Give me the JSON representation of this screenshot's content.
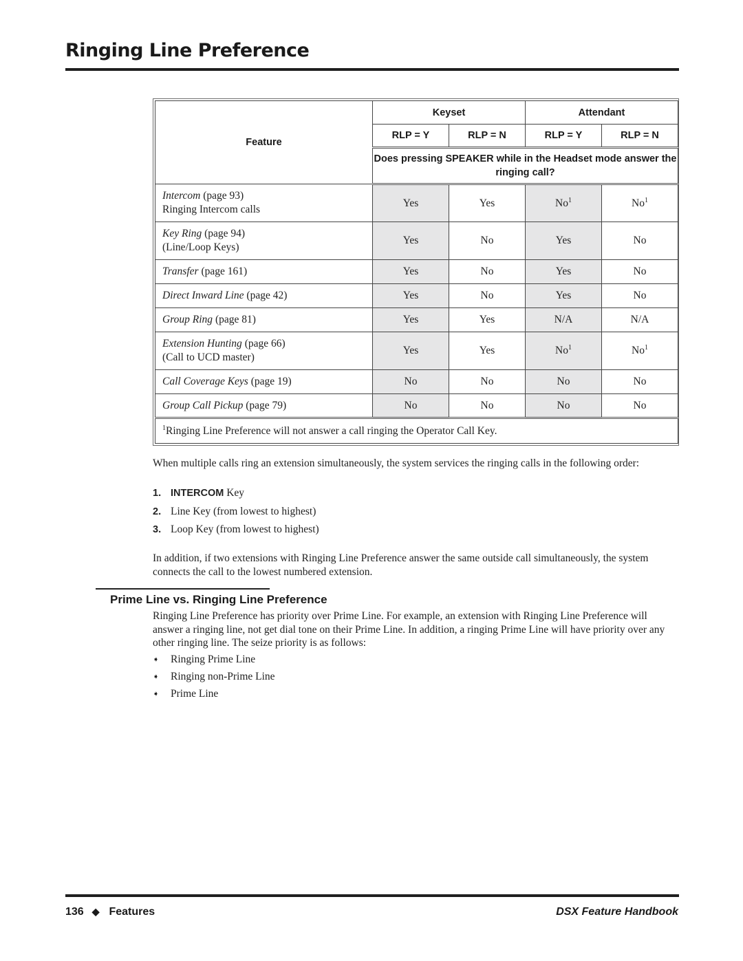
{
  "header": {
    "title": "Ringing Line Preference"
  },
  "table": {
    "feature_header": "Feature",
    "groups": [
      "Keyset",
      "Attendant"
    ],
    "rlp_headers": [
      "RLP = Y",
      "RLP = N",
      "RLP = Y",
      "RLP = N"
    ],
    "question_pre": "Does pressing ",
    "question_key": "SPEAKER",
    "question_post": " while in the Headset mode answer the ringing call?",
    "rows": [
      {
        "feature": "Intercom",
        "page": " (page 93)",
        "sub": "Ringing Intercom calls",
        "values": [
          "Yes",
          "Yes",
          "No",
          "No"
        ],
        "notes": [
          "",
          "",
          "1",
          "1"
        ]
      },
      {
        "feature": "Key Ring",
        "page": " (page 94)",
        "sub": "(Line/Loop Keys)",
        "values": [
          "Yes",
          "No",
          "Yes",
          "No"
        ],
        "notes": [
          "",
          "",
          "",
          ""
        ]
      },
      {
        "feature": "Transfer",
        "page": " (page 161)",
        "sub": "",
        "values": [
          "Yes",
          "No",
          "Yes",
          "No"
        ],
        "notes": [
          "",
          "",
          "",
          ""
        ]
      },
      {
        "feature": "Direct Inward Line",
        "page": " (page 42)",
        "sub": "",
        "values": [
          "Yes",
          "No",
          "Yes",
          "No"
        ],
        "notes": [
          "",
          "",
          "",
          ""
        ]
      },
      {
        "feature": "Group Ring",
        "page": " (page 81)",
        "sub": "",
        "values": [
          "Yes",
          "Yes",
          "N/A",
          "N/A"
        ],
        "notes": [
          "",
          "",
          "",
          ""
        ]
      },
      {
        "feature": "Extension Hunting",
        "page": " (page 66)",
        "sub": "(Call to UCD master)",
        "values": [
          "Yes",
          "Yes",
          "No",
          "No"
        ],
        "notes": [
          "",
          "",
          "1",
          "1"
        ]
      },
      {
        "feature": "Call Coverage Keys",
        "page": " (page 19)",
        "sub": "",
        "values": [
          "No",
          "No",
          "No",
          "No"
        ],
        "notes": [
          "",
          "",
          "",
          ""
        ]
      },
      {
        "feature": "Group Call Pickup",
        "page": " (page 79)",
        "sub": "",
        "values": [
          "No",
          "No",
          "No",
          "No"
        ],
        "notes": [
          "",
          "",
          "",
          ""
        ]
      }
    ],
    "footnote_mark": "1",
    "footnote": "Ringing Line Preference will not answer a call ringing the Operator Call Key."
  },
  "body": {
    "intro": "When multiple calls ring an extension simultaneously, the system services the ringing calls in the following order:",
    "order": [
      {
        "num": "1.",
        "key": "INTERCOM",
        "text": " Key"
      },
      {
        "num": "2.",
        "key": "",
        "text": "Line Key (from lowest to highest)"
      },
      {
        "num": "3.",
        "key": "",
        "text": "Loop Key (from lowest to highest)"
      }
    ],
    "addition": "In addition, if two extensions with Ringing Line Preference answer the same outside call simultaneously, the system connects the call to the lowest numbered extension."
  },
  "section": {
    "heading": "Prime Line vs. Ringing Line Preference",
    "paragraph": "Ringing Line Preference has priority over Prime Line. For example, an extension with Ringing Line Preference will answer a ringing line, not get dial tone on their Prime Line. In addition, a ringing Prime Line will have priority over any other ringing line. The seize priority is as follows:",
    "bullet_glyph": "➧",
    "bullets": [
      "Ringing Prime Line",
      "Ringing non-Prime Line",
      "Prime Line"
    ]
  },
  "footer": {
    "page_number": "136",
    "separator": "◆",
    "section": "Features",
    "book": "DSX Feature Handbook"
  }
}
